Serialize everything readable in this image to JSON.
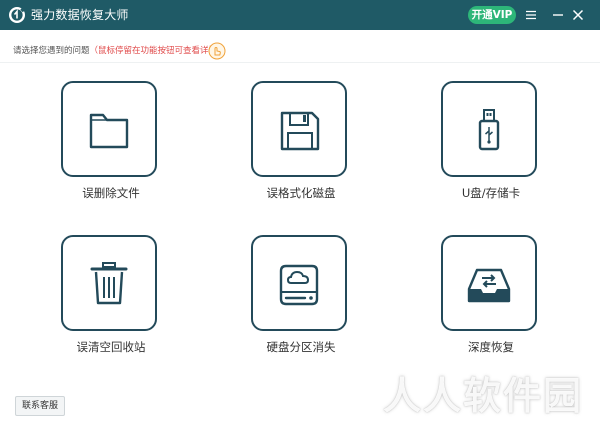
{
  "app": {
    "title": "强力数据恢复大师",
    "vip_label": "开通VIP"
  },
  "hint": {
    "prefix": "请选择您遇到的问题",
    "tip": "（鼠标停留在功能按钮可查看详情）"
  },
  "tiles": [
    {
      "label": "误删除文件",
      "icon": "folder-icon"
    },
    {
      "label": "误格式化磁盘",
      "icon": "floppy-disk-icon"
    },
    {
      "label": "U盘/存储卡",
      "icon": "usb-drive-icon"
    },
    {
      "label": "误清空回收站",
      "icon": "trash-bin-icon"
    },
    {
      "label": "硬盘分区消失",
      "icon": "cloud-drive-icon"
    },
    {
      "label": "深度恢复",
      "icon": "inbox-tray-icon"
    }
  ],
  "footer": {
    "contact_label": "联系客服"
  },
  "watermark": "人人软件园",
  "colors": {
    "titlebar": "#1f5a66",
    "vip_button": "#2db679",
    "tile_border": "#234a5a",
    "hint_red": "#e04a4a",
    "hint_icon": "#f0a23a"
  }
}
